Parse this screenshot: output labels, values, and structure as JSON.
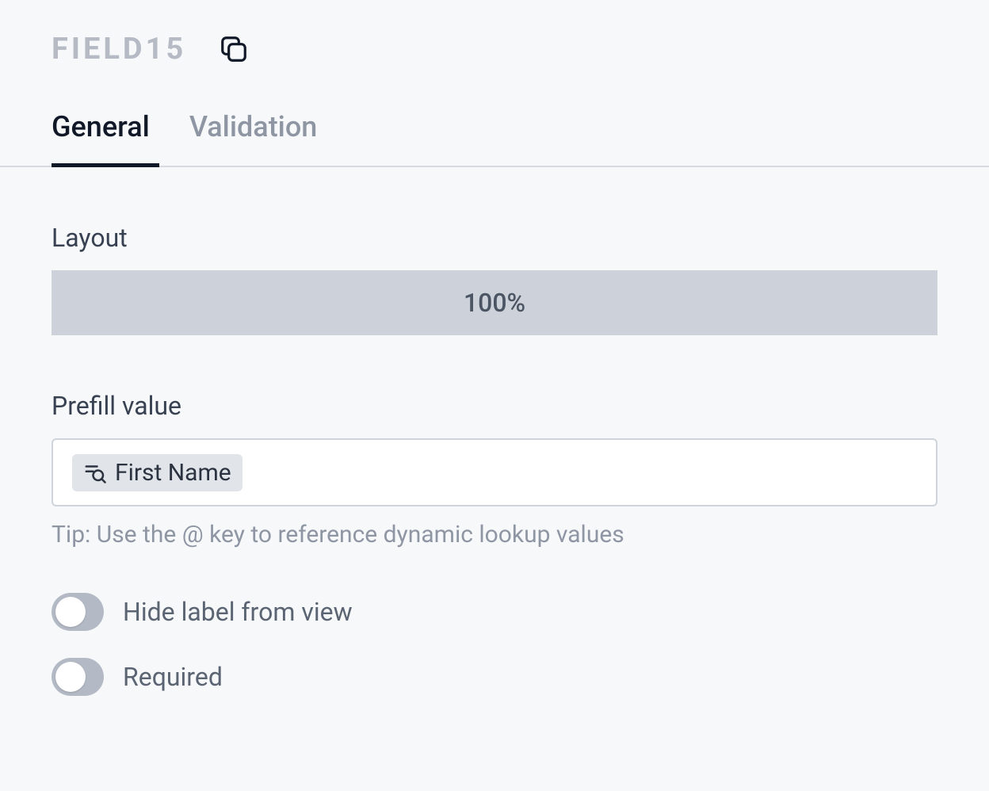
{
  "header": {
    "code": "FIELD15"
  },
  "tabs": {
    "general": "General",
    "validation": "Validation"
  },
  "layout": {
    "label": "Layout",
    "value": "100%"
  },
  "prefill": {
    "label": "Prefill value",
    "token_text": "First Name",
    "tip": "Tip: Use the @ key to reference dynamic lookup values"
  },
  "toggles": {
    "hide_label": "Hide label from view",
    "required": "Required"
  }
}
